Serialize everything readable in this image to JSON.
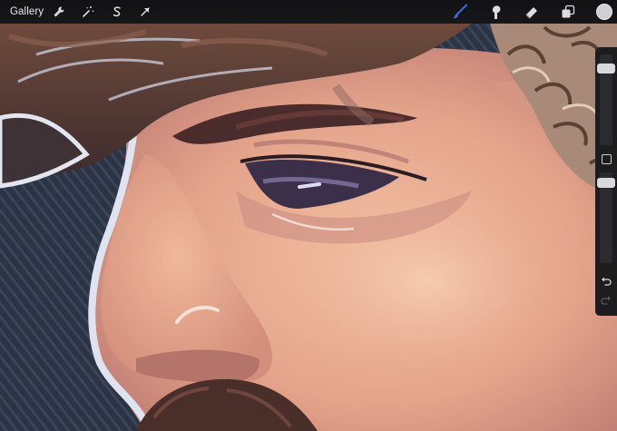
{
  "toolbar": {
    "gallery_label": "Gallery",
    "left_tools": [
      {
        "name": "actions",
        "icon": "wrench-icon"
      },
      {
        "name": "adjustments",
        "icon": "magic-wand-icon"
      },
      {
        "name": "selection",
        "icon": "selection-s-icon"
      },
      {
        "name": "transform",
        "icon": "arrow-cursor-icon"
      }
    ],
    "right_tools": [
      {
        "name": "brush",
        "icon": "brush-icon",
        "active": true
      },
      {
        "name": "smudge",
        "icon": "smudge-finger-icon"
      },
      {
        "name": "eraser",
        "icon": "eraser-icon"
      },
      {
        "name": "layers",
        "icon": "layers-icon"
      },
      {
        "name": "color",
        "icon": "color-circle"
      }
    ]
  },
  "colors": {
    "active_tool": "#3d6df0",
    "current_color": "#cfcfd6",
    "toolbar_bg": "#141416",
    "sidebar_bg": "#1d1d20"
  },
  "sidebar": {
    "brush_size_level": 0.12,
    "opacity_level": 0.06,
    "icons": [
      "modify-square-icon",
      "undo-icon",
      "redo-icon"
    ]
  }
}
